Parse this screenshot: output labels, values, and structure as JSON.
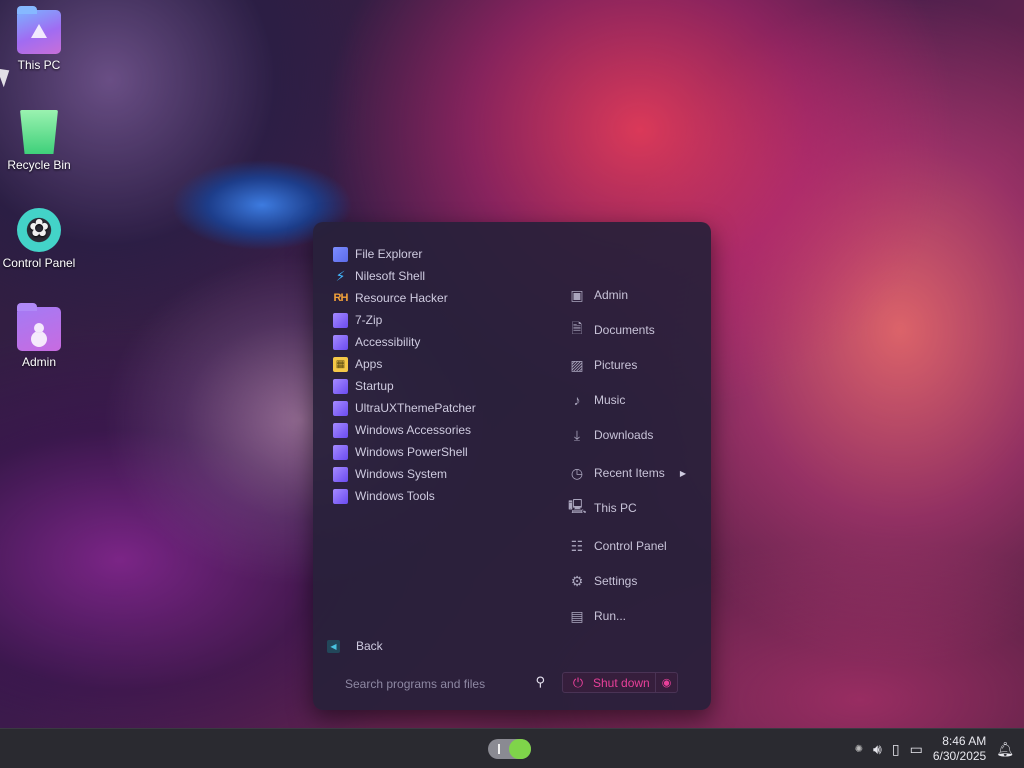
{
  "desktop": {
    "icons": [
      {
        "label": "This PC",
        "icon": "this-pc-folder-icon"
      },
      {
        "label": "Recycle Bin",
        "icon": "recycle-bin-icon"
      },
      {
        "label": "Control Panel",
        "icon": "control-panel-icon"
      },
      {
        "label": "Admin",
        "icon": "user-folder-icon"
      }
    ]
  },
  "start_menu": {
    "programs": [
      {
        "label": "File Explorer",
        "icon": "file-explorer-icon"
      },
      {
        "label": "Nilesoft Shell",
        "icon": "nilesoft-shell-icon"
      },
      {
        "label": "Resource Hacker",
        "icon": "resource-hacker-icon",
        "glyph": "RH"
      },
      {
        "label": "7-Zip",
        "icon": "folder-icon"
      },
      {
        "label": "Accessibility",
        "icon": "folder-icon"
      },
      {
        "label": "Apps",
        "icon": "apps-folder-icon"
      },
      {
        "label": "Startup",
        "icon": "folder-icon"
      },
      {
        "label": "UltraUXThemePatcher",
        "icon": "folder-icon"
      },
      {
        "label": "Windows Accessories",
        "icon": "folder-icon"
      },
      {
        "label": "Windows PowerShell",
        "icon": "folder-icon"
      },
      {
        "label": "Windows System",
        "icon": "folder-icon"
      },
      {
        "label": "Windows Tools",
        "icon": "folder-icon"
      }
    ],
    "places": [
      {
        "label": "Admin",
        "icon": "user-folder-icon"
      },
      {
        "label": "Documents",
        "icon": "document-icon"
      },
      {
        "label": "Pictures",
        "icon": "picture-icon"
      },
      {
        "label": "Music",
        "icon": "music-note-icon"
      },
      {
        "label": "Downloads",
        "icon": "download-icon"
      },
      {
        "label": "Recent Items",
        "icon": "clock-icon"
      },
      {
        "label": "This PC",
        "icon": "computer-icon"
      },
      {
        "label": "Control Panel",
        "icon": "control-panel-icon"
      },
      {
        "label": "Settings",
        "icon": "gear-icon"
      },
      {
        "label": "Run...",
        "icon": "run-icon"
      }
    ],
    "back_label": "Back",
    "search_placeholder": "Search programs and files",
    "shutdown_label": "Shut down"
  },
  "taskbar": {
    "time": "8:46 AM",
    "date": "6/30/2025",
    "tray_icons": [
      "brightness-icon",
      "volume-icon",
      "battery-icon",
      "network-icon",
      "notification-bell-icon"
    ]
  },
  "colors": {
    "menu_bg": "#28203a",
    "accent_shutdown": "#e8409a",
    "toggle_on": "#7fd44a"
  }
}
